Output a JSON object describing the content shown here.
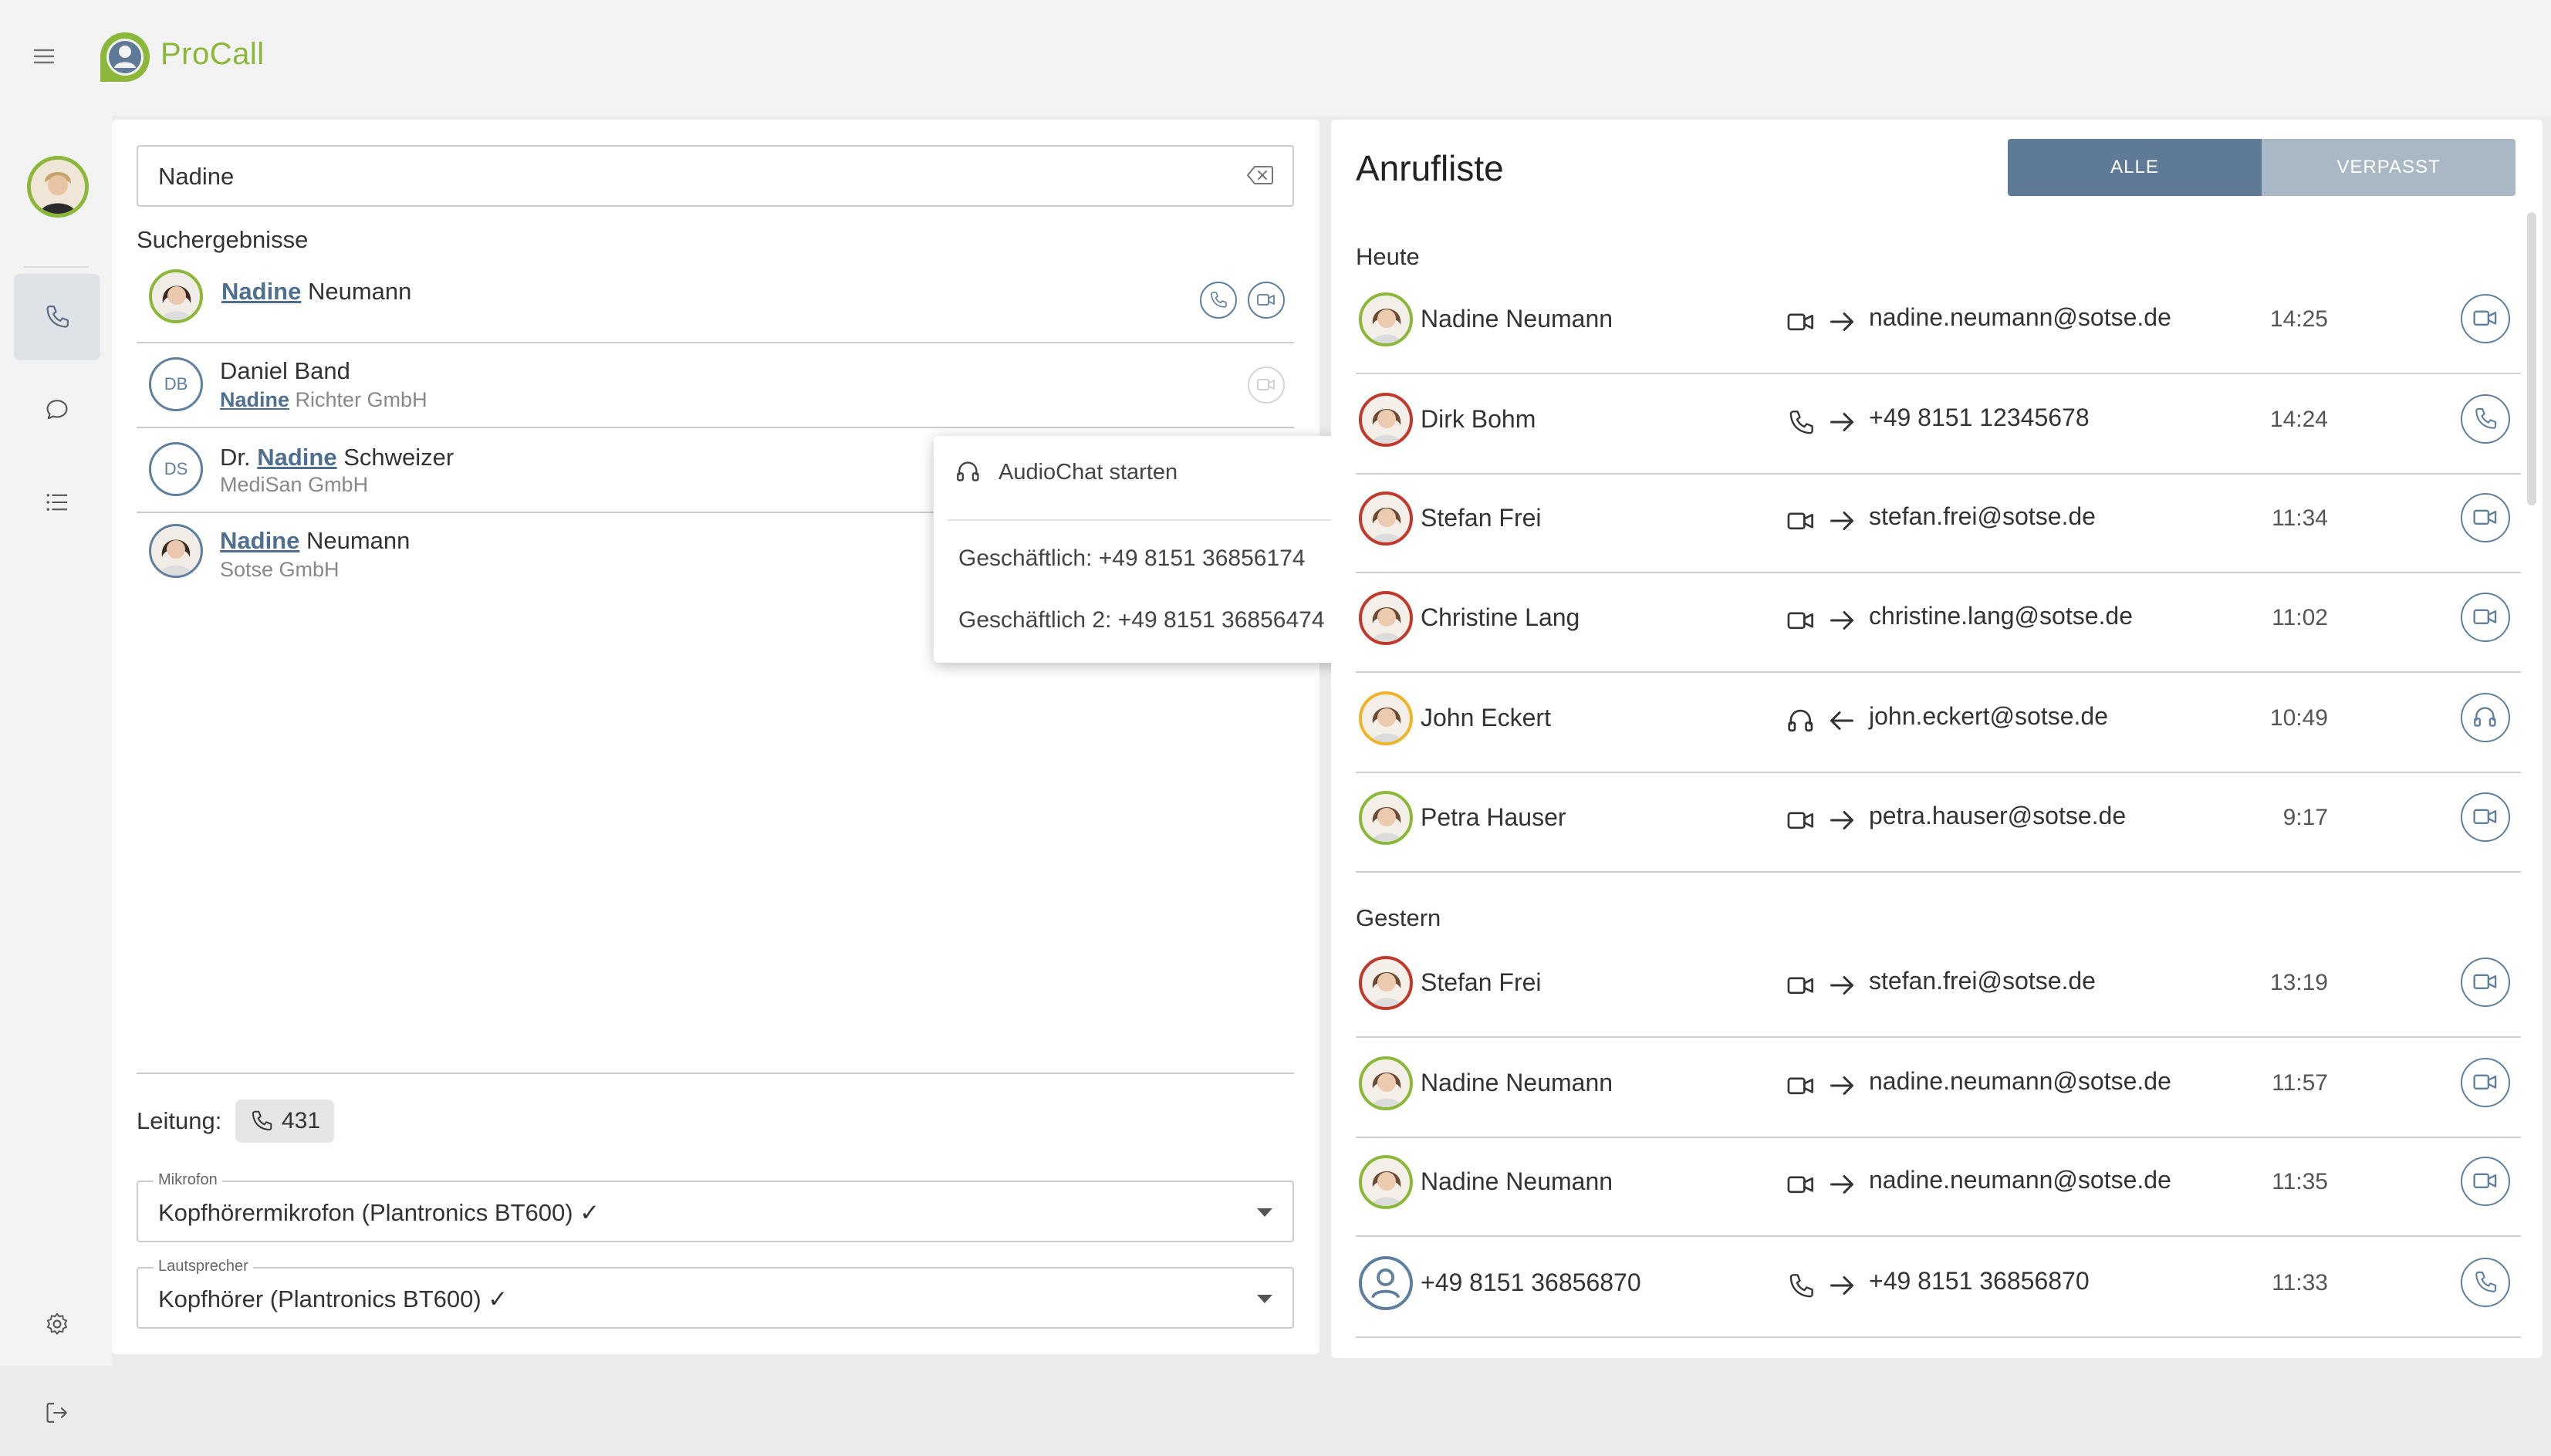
{
  "app": {
    "name": "ProCall"
  },
  "nav": {
    "items": [
      "phone",
      "chat",
      "list"
    ]
  },
  "search": {
    "value": "Nadine",
    "results_title": "Suchergebnisse"
  },
  "results": [
    {
      "hl": "Nadine",
      "rest": " Neumann",
      "prefix": "",
      "sub_hl": "",
      "sub": ""
    },
    {
      "prefix": "Daniel Band",
      "hl": "",
      "rest": "",
      "initials": "DB",
      "sub_hl": "Nadine",
      "sub": " Richter GmbH"
    },
    {
      "prefix": "Dr. ",
      "hl": "Nadine",
      "rest": " Schweizer",
      "initials": "DS",
      "sub_hl": "",
      "sub": "MediSan GmbH"
    },
    {
      "prefix": "",
      "hl": "Nadine",
      "rest": " Neumann",
      "sub_hl": "",
      "sub": "Sotse GmbH"
    }
  ],
  "popup": {
    "audio": "AudioChat starten",
    "items": [
      "Geschäftlich: +49 8151 36856174",
      "Geschäftlich 2: +49 8151 36856474"
    ]
  },
  "line": {
    "label": "Leitung:",
    "number": "431"
  },
  "devices": {
    "mic_label": "Mikrofon",
    "mic_value": "Kopfhörermikrofon (Plantronics BT600) ✓",
    "spk_label": "Lautsprecher",
    "spk_value": "Kopfhörer (Plantronics BT600) ✓"
  },
  "calls": {
    "title": "Anrufliste",
    "filter_all": "ALLE",
    "filter_missed": "VERPASST",
    "today": "Heute",
    "yesterday": "Gestern",
    "items": [
      {
        "name": "Nadine Neumann",
        "type": "video",
        "dir": "out",
        "target": "nadine.neumann@sotse.de",
        "time": "14:25",
        "ring": "#8cb83a"
      },
      {
        "name": "Dirk Bohm",
        "type": "phone",
        "dir": "out",
        "target": "+49 8151 12345678",
        "time": "14:24",
        "ring": "#c0392b"
      },
      {
        "name": "Stefan Frei",
        "type": "video",
        "dir": "out",
        "target": "stefan.frei@sotse.de",
        "time": "11:34",
        "ring": "#c0392b"
      },
      {
        "name": "Christine Lang",
        "type": "video",
        "dir": "out",
        "target": "christine.lang@sotse.de",
        "time": "11:02",
        "ring": "#c0392b"
      },
      {
        "name": "John Eckert",
        "type": "audio",
        "dir": "in",
        "target": "john.eckert@sotse.de",
        "time": "10:49",
        "ring": "#f0b429"
      },
      {
        "name": "Petra Hauser",
        "type": "video",
        "dir": "out",
        "target": "petra.hauser@sotse.de",
        "time": "9:17",
        "ring": "#8cb83a"
      },
      {
        "name": "Stefan Frei",
        "type": "video",
        "dir": "out",
        "target": "stefan.frei@sotse.de",
        "time": "13:19",
        "ring": "#c0392b"
      },
      {
        "name": "Nadine Neumann",
        "type": "video",
        "dir": "out",
        "target": "nadine.neumann@sotse.de",
        "time": "11:57",
        "ring": "#8cb83a"
      },
      {
        "name": "Nadine Neumann",
        "type": "video",
        "dir": "out",
        "target": "nadine.neumann@sotse.de",
        "time": "11:35",
        "ring": "#8cb83a"
      },
      {
        "name": "+49 8151 36856870",
        "type": "phone",
        "dir": "out",
        "target": "+49 8151 36856870",
        "time": "11:33",
        "ring": "#5f7f9f"
      }
    ]
  }
}
